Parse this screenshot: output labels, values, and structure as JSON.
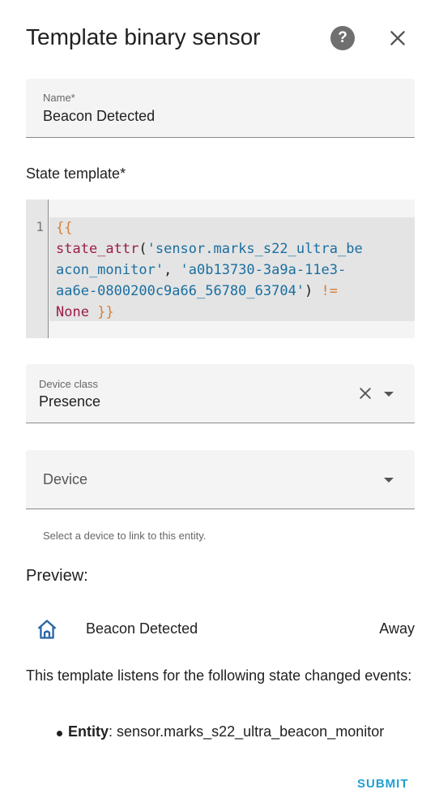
{
  "dialog": {
    "title": "Template binary sensor",
    "help_glyph": "?"
  },
  "name_field": {
    "label": "Name*",
    "value": "Beacon Detected"
  },
  "state_template": {
    "label": "State template*",
    "line_number": "1",
    "code": {
      "open": "{{",
      "fn": "state_attr",
      "paren_open": "(",
      "arg1": "'sensor.marks_s22_ultra_be\nacon_monitor'",
      "comma": ", ",
      "arg2": "'a0b13730-3a9a-11e3-\naa6e-0800200c9a66_56780_63704'",
      "paren_close": ")",
      "op": " !=",
      "none": "None",
      "close": "}}"
    }
  },
  "device_class": {
    "label": "Device class",
    "value": "Presence"
  },
  "device": {
    "placeholder": "Device",
    "helper": "Select a device to link to this entity."
  },
  "preview": {
    "label": "Preview:",
    "entity_name": "Beacon Detected",
    "entity_state": "Away",
    "listen_text": "This template listens for the following state changed events:",
    "entities": [
      {
        "kind": "Entity",
        "id": "sensor.marks_s22_ultra_beacon_monitor"
      }
    ]
  },
  "actions": {
    "submit": "SUBMIT"
  },
  "colors": {
    "accent": "#1ea0d4",
    "icon_blue": "#2a65a8"
  }
}
